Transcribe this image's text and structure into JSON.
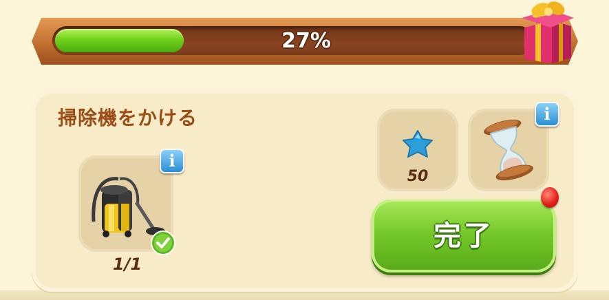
{
  "progress": {
    "percent_label": "27%",
    "fraction": 0.27,
    "fill_color": "#70d31b"
  },
  "reward": {
    "icon": "gift-box-icon"
  },
  "task": {
    "title": "掃除機をかける",
    "required_item": {
      "icon": "vacuum-cleaner-icon",
      "count_label": "1/1",
      "completed": true,
      "info_icon": "info-icon"
    },
    "rewards": [
      {
        "icon": "blue-star-icon",
        "value": "50"
      },
      {
        "icon": "hourglass-icon",
        "info_icon": "info-icon"
      }
    ],
    "complete_button": {
      "label": "完了",
      "color": "#76c92a"
    },
    "notification_color": "#e5231a"
  }
}
